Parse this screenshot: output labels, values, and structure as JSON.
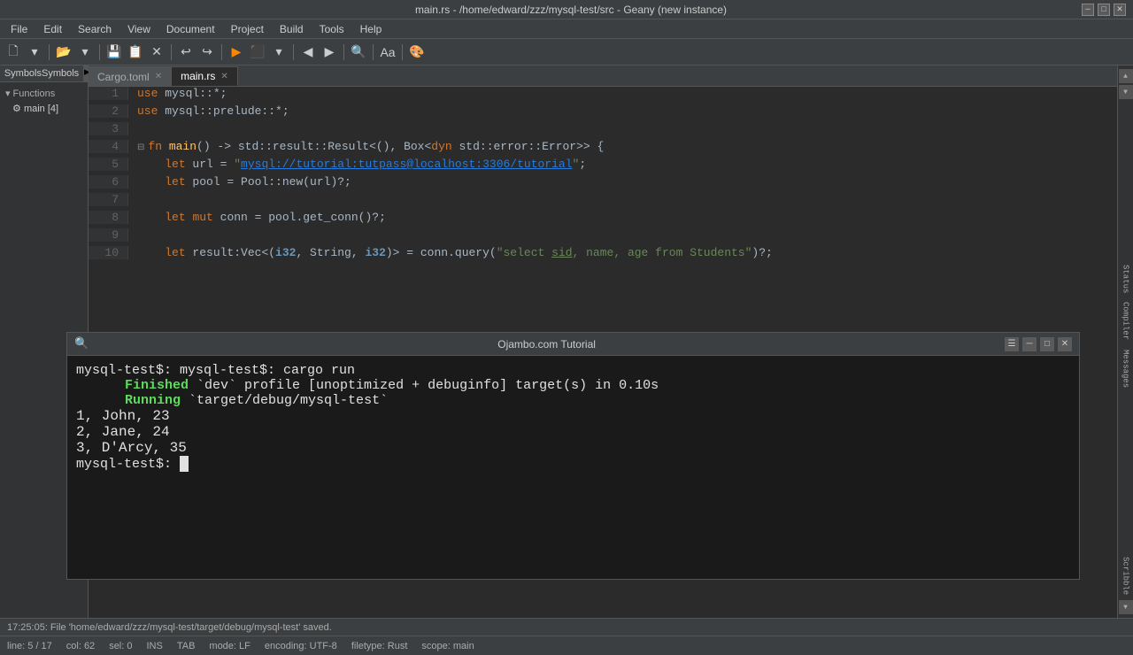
{
  "titlebar": {
    "title": "main.rs - /home/edward/zzz/mysql-test/src - Geany (new instance)",
    "minimize": "─",
    "maximize": "□",
    "close": "✕"
  },
  "menubar": {
    "items": [
      "File",
      "Edit",
      "Search",
      "View",
      "Document",
      "Project",
      "Build",
      "Tools",
      "Help"
    ]
  },
  "tabs": {
    "items": [
      {
        "label": "Cargo.toml",
        "active": false
      },
      {
        "label": "main.rs",
        "active": true
      }
    ]
  },
  "sidebar": {
    "tabs": [
      {
        "label": "Symbols",
        "active": false
      },
      {
        "label": ""
      }
    ],
    "section": "Functions",
    "items": [
      "main [4]"
    ]
  },
  "code": {
    "lines": [
      {
        "num": "1",
        "content": "use mysql::*;"
      },
      {
        "num": "2",
        "content": "use mysql::prelude::*;"
      },
      {
        "num": "3",
        "content": ""
      },
      {
        "num": "4",
        "content": "fn main() -> std::result::Result<(), Box<dyn std::error::Error>> {",
        "fold": true
      },
      {
        "num": "5",
        "content": "    let url = \"mysql://tutorial:tutpass@localhost:3306/tutorial\";"
      },
      {
        "num": "6",
        "content": "    let pool = Pool::new(url)?;"
      },
      {
        "num": "7",
        "content": ""
      },
      {
        "num": "8",
        "content": "    let mut conn = pool.get_conn()?;"
      },
      {
        "num": "9",
        "content": ""
      },
      {
        "num": "10",
        "content": "    let result:Vec<(i32, String, i32)> = conn.query(\"select sid, name, age from Students\")?"
      }
    ]
  },
  "terminal": {
    "title": "Ojambo.com Tutorial",
    "prompt1": "mysql-test$: cargo run",
    "finished_label": "Finished",
    "finished_text": "`dev` profile [unoptimized + debuginfo] target(s) in 0.10s",
    "running_label": "Running",
    "running_text": "`target/debug/mysql-test`",
    "data_rows": [
      "1, John, 23",
      "2, Jane, 24",
      "3, D'Arcy, 35"
    ],
    "prompt2": "mysql-test$: "
  },
  "bottom_notification": {
    "items": [
      {
        "label": "17:",
        "value": "17:..."
      },
      {
        "label": "17:",
        "value": "17:..."
      },
      {
        "label": "17:",
        "value": "17:..."
      },
      {
        "label": "17:",
        "value": "17:..."
      },
      {
        "label": "17:",
        "value": "17:..."
      }
    ],
    "long_text": "17:25:05: File 'home/edward/zzz/mysql-test/target/debug/mysql-test' saved."
  },
  "statusbar": {
    "line": "line: 5 / 17",
    "col": "col: 62",
    "sel": "sel: 0",
    "ins": "INS",
    "tab": "TAB",
    "mode": "mode: LF",
    "encoding": "encoding: UTF-8",
    "filetype": "filetype: Rust",
    "scope": "scope: main"
  }
}
